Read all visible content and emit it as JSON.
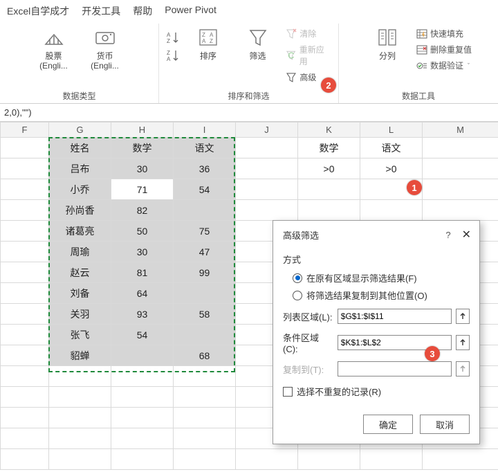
{
  "tabs": [
    "Excel自学成才",
    "开发工具",
    "帮助",
    "Power Pivot"
  ],
  "ribbon": {
    "group_datatype": {
      "label": "数据类型",
      "stocks": "股票 (Engli...",
      "currency": "货币 (Engli..."
    },
    "group_sortfilter": {
      "label": "排序和筛选",
      "sort": "排序",
      "filter": "筛选",
      "clear": "清除",
      "reapply": "重新应用",
      "advanced": "高级"
    },
    "group_datatools": {
      "label": "数据工具",
      "texttocols": "分列",
      "flashfill": "快速填充",
      "removedup": "删除重复值",
      "datavalidation": "数据验证"
    }
  },
  "formula_bar": "2,0),\"\")",
  "columns": [
    "F",
    "G",
    "H",
    "I",
    "J",
    "K",
    "L",
    "M"
  ],
  "header_row": {
    "G": "姓名",
    "H": "数学",
    "I": "语文",
    "K": "数学",
    "L": "语文"
  },
  "criteria_row": {
    "K": ">0",
    "L": ">0"
  },
  "chart_data": {
    "type": "table",
    "columns": [
      "姓名",
      "数学",
      "语文"
    ],
    "rows": [
      {
        "name": "吕布",
        "math": "30",
        "chinese": "36"
      },
      {
        "name": "小乔",
        "math": "71",
        "chinese": "54"
      },
      {
        "name": "孙尚香",
        "math": "82",
        "chinese": ""
      },
      {
        "name": "诸葛亮",
        "math": "50",
        "chinese": "75"
      },
      {
        "name": "周瑜",
        "math": "30",
        "chinese": "47"
      },
      {
        "name": "赵云",
        "math": "81",
        "chinese": "99"
      },
      {
        "name": "刘备",
        "math": "64",
        "chinese": ""
      },
      {
        "name": "关羽",
        "math": "93",
        "chinese": "58"
      },
      {
        "name": "张飞",
        "math": "54",
        "chinese": ""
      },
      {
        "name": "貂蝉",
        "math": "",
        "chinese": "68"
      }
    ]
  },
  "dialog": {
    "title": "高级筛选",
    "section": "方式",
    "opt_inplace": "在原有区域显示筛选结果(F)",
    "opt_copy": "将筛选结果复制到其他位置(O)",
    "list_label": "列表区域(L):",
    "list_value": "$G$1:$I$11",
    "crit_label": "条件区域(C):",
    "crit_value": "$K$1:$L$2",
    "copy_label": "复制到(T):",
    "copy_value": "",
    "unique": "选择不重复的记录(R)",
    "ok": "确定",
    "cancel": "取消"
  },
  "badges": {
    "b1": "1",
    "b2": "2",
    "b3": "3"
  }
}
